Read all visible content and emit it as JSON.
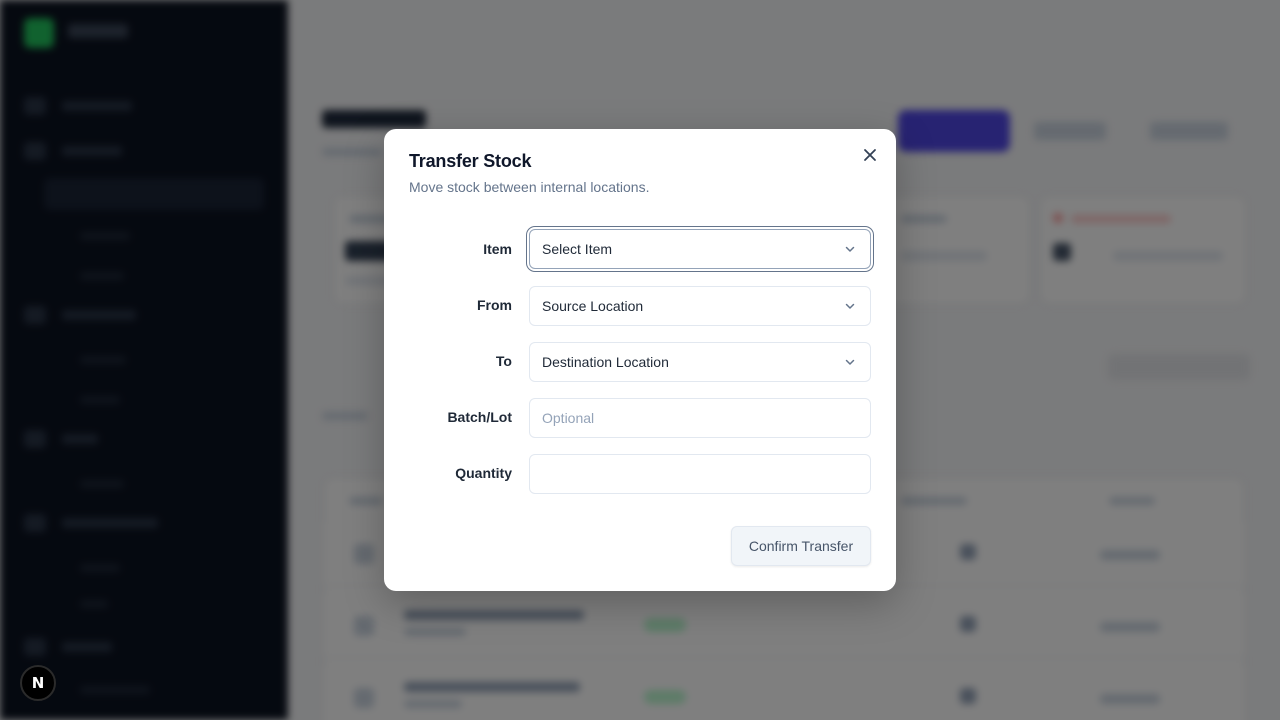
{
  "dialog": {
    "title": "Transfer Stock",
    "description": "Move stock between internal locations.",
    "close_icon": "close-icon",
    "fields": {
      "item": {
        "label": "Item",
        "value": "Select Item",
        "icon": "chevron-down-icon"
      },
      "from": {
        "label": "From",
        "value": "Source Location",
        "icon": "chevron-down-icon"
      },
      "to": {
        "label": "To",
        "value": "Destination Location",
        "icon": "chevron-down-icon"
      },
      "batch": {
        "label": "Batch/Lot",
        "value": "",
        "placeholder": "Optional"
      },
      "quantity": {
        "label": "Quantity",
        "value": "",
        "placeholder": ""
      }
    },
    "confirm_label": "Confirm Transfer"
  },
  "nextjs_badge": "N",
  "colors": {
    "sidebar_bg": "#0b1220",
    "accent": "#4f46e5",
    "success": "#22c55e",
    "overlay": "rgba(0,0,0,0.5)"
  }
}
